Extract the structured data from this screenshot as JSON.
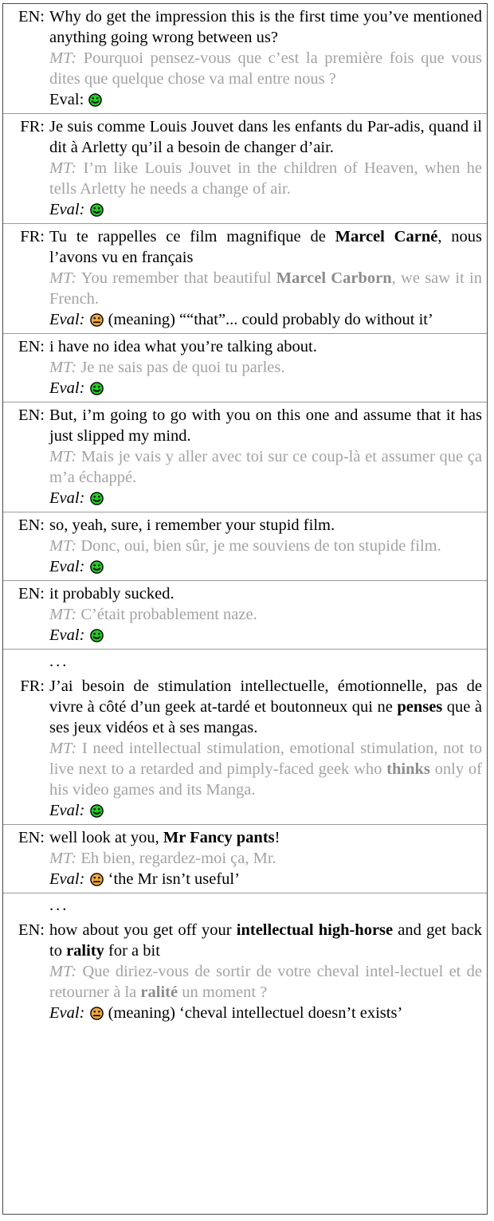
{
  "figure": {
    "kind": "dialogue-evaluation-table",
    "colors": {
      "source_text": "#000000",
      "mt_text": "#a3a3a3",
      "mt_bold_text": "#8c8c8c",
      "good_face": "#22cc22",
      "neutral_face": "#f0a93c",
      "face_outline": "#000000",
      "border": "#4a4a4a",
      "row_separator": "#9a9a9a"
    },
    "labels": {
      "mt_tag": "MT:",
      "eval_tag": "Eval:",
      "ellipsis": "..."
    }
  },
  "rows": [
    {
      "type": "turn",
      "lang": "EN:",
      "source_html": "Why do get the impression this is the first time you’ve mentioned anything going wrong between us?",
      "mt_html": "Pourquoi pensez-vous que c’est la première fois que vous dites que quelque chose va mal entre nous ?",
      "eval_tag_italic": false,
      "eval_face": "good",
      "eval_comment": ""
    },
    {
      "type": "turn",
      "lang": "FR:",
      "source_html": "Je suis comme Louis Jouvet dans les enfants du Par-adis, quand il dit à Arletty qu’il a besoin de changer d’air.",
      "mt_html": "I’m like Louis Jouvet in the children of Heaven, when he tells Arletty he needs a change of air.",
      "eval_tag_italic": true,
      "eval_face": "good",
      "eval_comment": ""
    },
    {
      "type": "turn",
      "lang": "FR:",
      "source_html": "Tu te rappelles ce film magnifique de <b>Marcel Carné</b>, nous l’avons vu en français",
      "mt_html": "You remember that beautiful <b>Marcel Carborn</b>, we saw it in French.",
      "eval_tag_italic": true,
      "eval_face": "neutral",
      "eval_comment": "(meaning) ““that”... could probably do without it’"
    },
    {
      "type": "turn",
      "lang": "EN:",
      "source_html": "i have no idea what you’re talking about.",
      "mt_html": "Je ne sais pas de quoi tu parles.",
      "eval_tag_italic": true,
      "eval_face": "good",
      "eval_comment": ""
    },
    {
      "type": "turn",
      "lang": "EN:",
      "source_html": "But, i’m going to go with you on this one and assume that it has just slipped my mind.",
      "mt_html": "Mais je vais y aller avec toi sur ce coup-là et assumer que ça m’a échappé.",
      "eval_tag_italic": true,
      "eval_face": "good",
      "eval_comment": ""
    },
    {
      "type": "turn",
      "lang": "EN:",
      "source_html": "so, yeah, sure, i remember your stupid film.",
      "mt_html": "Donc, oui, bien sûr, je me souviens de ton stupide film.",
      "eval_tag_italic": true,
      "eval_face": "good",
      "eval_comment": ""
    },
    {
      "type": "turn",
      "lang": "EN:",
      "source_html": "it probably sucked.",
      "mt_html": "C’était probablement naze.",
      "eval_tag_italic": true,
      "eval_face": "good",
      "eval_comment": ""
    },
    {
      "type": "ellipsis",
      "text": "..."
    },
    {
      "type": "turn",
      "lang": "FR:",
      "source_html": "J’ai besoin de stimulation intellectuelle, émotionnelle, pas de vivre à côté d’un geek at-tardé et boutonneux qui ne <b>penses</b> que à ses jeux vidéos et à ses mangas.",
      "mt_html": "I need intellectual stimulation, emotional stimulation, not to live next to a retarded and pimply-faced geek who <b>thinks</b> only of his video games and its Manga.",
      "eval_tag_italic": true,
      "eval_face": "good",
      "eval_comment": ""
    },
    {
      "type": "turn",
      "lang": "EN:",
      "source_html": "well look at you, <b>Mr Fancy pants</b>!",
      "mt_html": "Eh bien, regardez-moi ça, Mr.",
      "eval_tag_italic": true,
      "eval_face": "neutral",
      "eval_comment": "‘the Mr isn’t useful’"
    },
    {
      "type": "ellipsis",
      "text": "..."
    },
    {
      "type": "turn",
      "lang": "EN:",
      "source_html": "how about you get off your <b>intellectual high-horse</b> and get back to <b>rality</b> for a bit",
      "mt_html": "Que diriez-vous de sortir de votre cheval intel-lectuel et de retourner à la <b>ralité</b> un moment ?",
      "eval_tag_italic": true,
      "eval_face": "neutral",
      "eval_comment": "(meaning) ‘cheval intellectuel doesn’t exists’"
    }
  ]
}
